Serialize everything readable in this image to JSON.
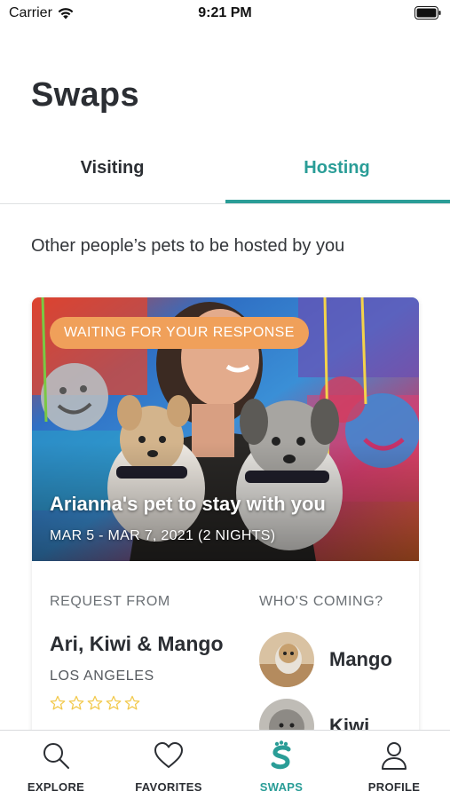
{
  "status_bar": {
    "carrier": "Carrier",
    "time": "9:21 PM"
  },
  "page": {
    "title": "Swaps"
  },
  "tabs": [
    {
      "label": "Visiting",
      "active": false
    },
    {
      "label": "Hosting",
      "active": true
    }
  ],
  "subtitle": "Other people’s pets to be hosted by you",
  "request_card": {
    "status_badge": "WAITING FOR YOUR RESPONSE",
    "title": "Arianna's pet to stay with you",
    "dates": "MAR 5 - MAR 7, 2021 (2 NIGHTS)",
    "request_label": "REQUEST FROM",
    "requester": "Ari, Kiwi & Mango",
    "city": "LOS ANGELES",
    "rating": 0,
    "rating_max": 5,
    "coming_label": "WHO'S COMING?",
    "pets": [
      {
        "name": "Mango"
      },
      {
        "name": "Kiwi"
      }
    ]
  },
  "bottom_nav": [
    {
      "label": "EXPLORE",
      "icon": "search-icon",
      "active": false
    },
    {
      "label": "FAVORITES",
      "icon": "heart-icon",
      "active": false
    },
    {
      "label": "SWAPS",
      "icon": "swaps-logo-icon",
      "active": true
    },
    {
      "label": "PROFILE",
      "icon": "person-icon",
      "active": false
    }
  ],
  "colors": {
    "accent": "#2a9d97",
    "badge": "#f0a05a",
    "text": "#2b2e33",
    "star": "#f2c94c"
  }
}
